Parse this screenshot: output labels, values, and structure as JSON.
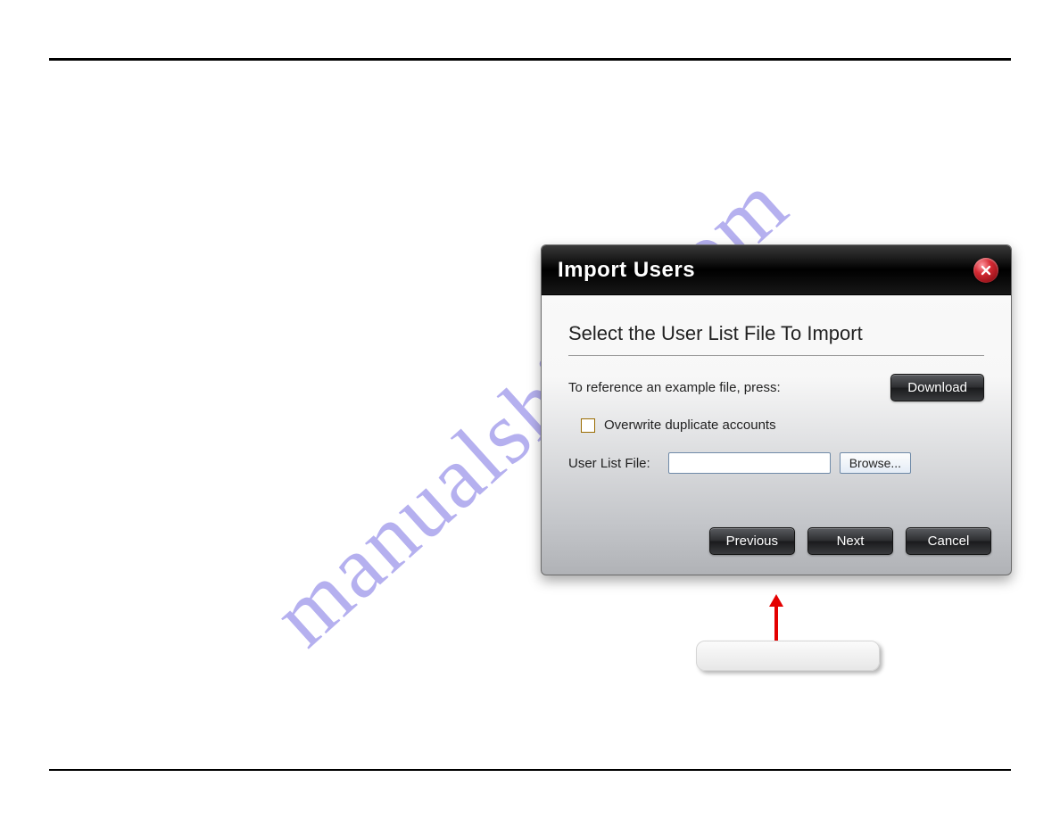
{
  "watermark": {
    "text": "manualshive.com"
  },
  "dialog": {
    "title": "Import Users",
    "section_heading": "Select the User List File To Import",
    "example_label": "To reference an example file, press:",
    "download_label": "Download",
    "overwrite_label": "Overwrite duplicate accounts",
    "overwrite_checked": false,
    "file_label": "User List File:",
    "file_value": "",
    "browse_label": "Browse...",
    "buttons": {
      "previous": "Previous",
      "next": "Next",
      "cancel": "Cancel"
    }
  }
}
